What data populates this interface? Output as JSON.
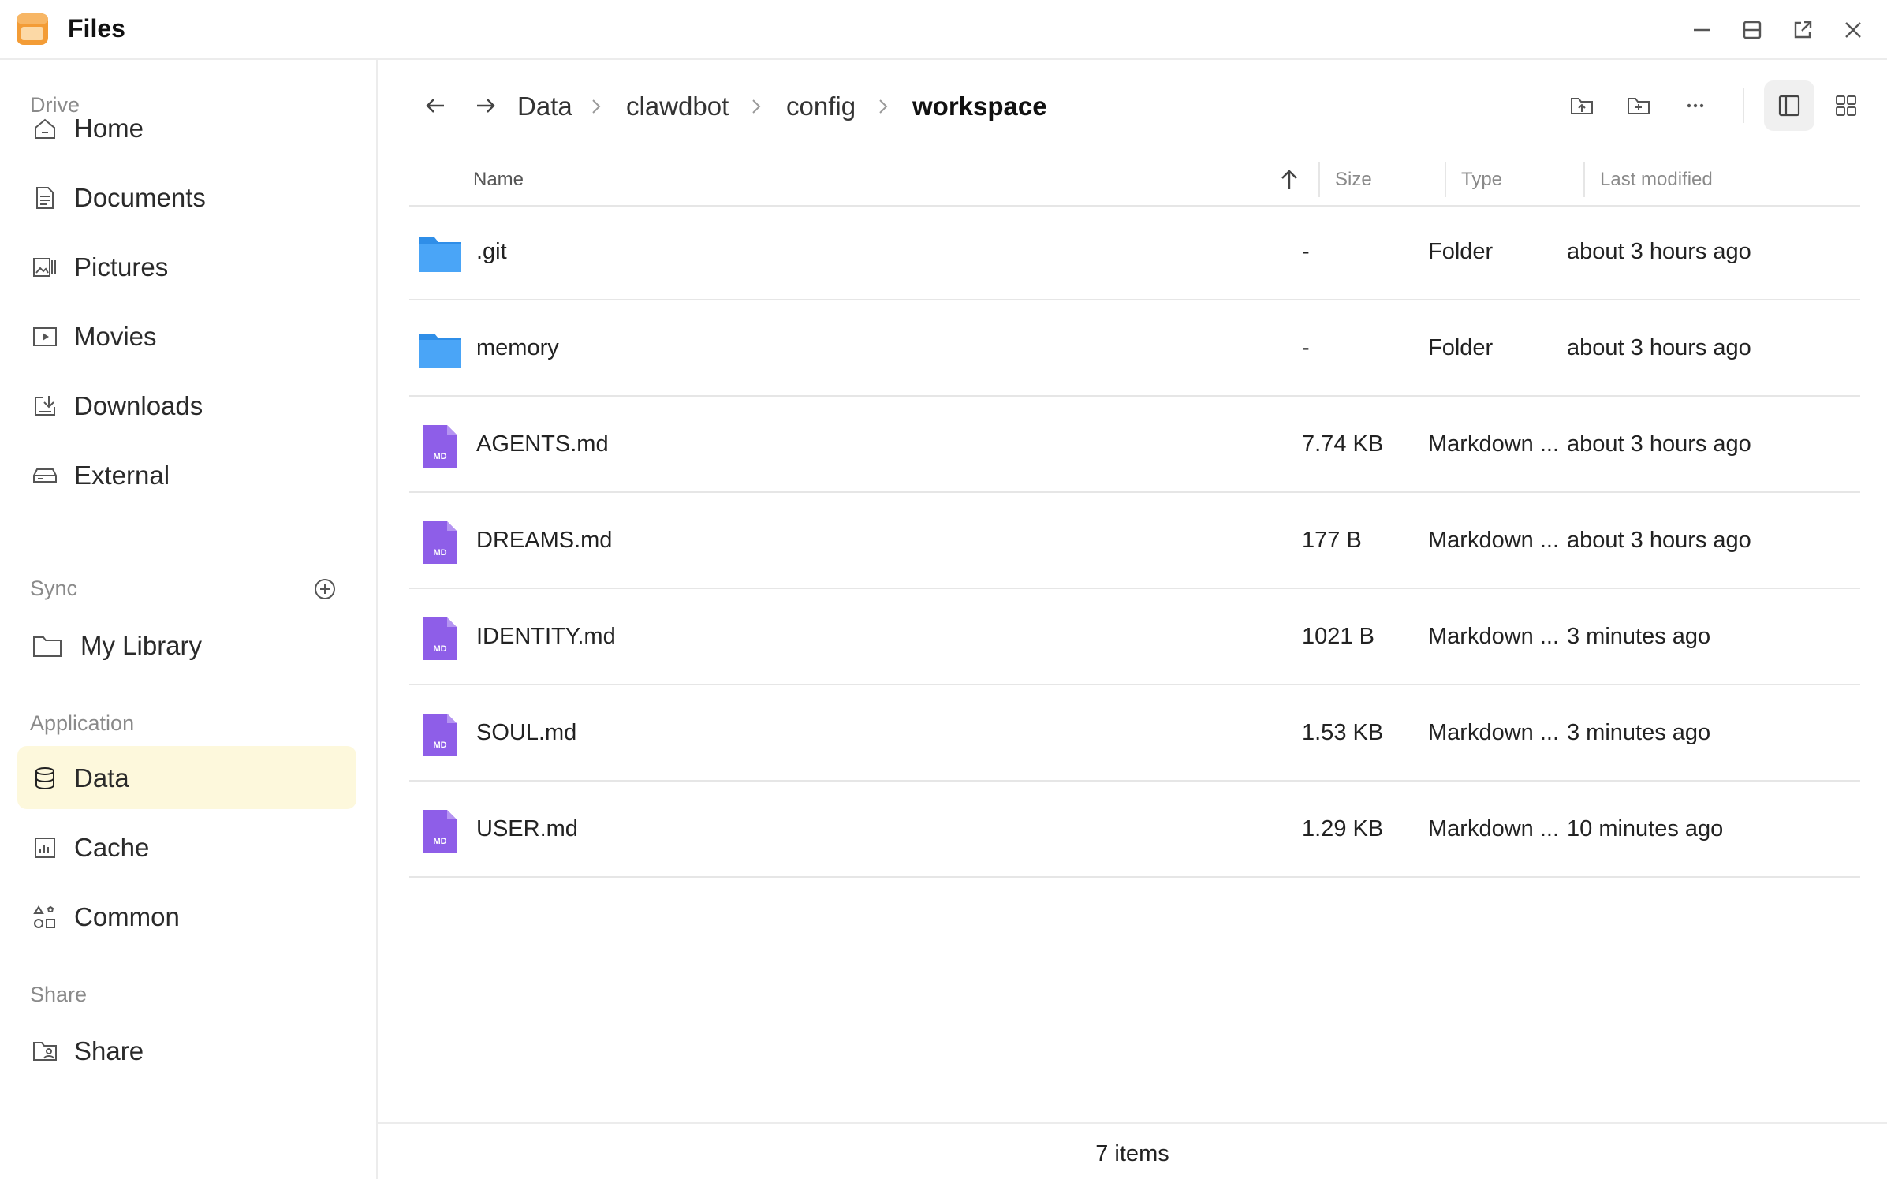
{
  "window": {
    "title": "Files",
    "controls": [
      "minimize-icon",
      "restore-icon",
      "popout-icon",
      "close-icon"
    ]
  },
  "sidebar": {
    "sections": [
      {
        "title": "Drive",
        "items": [
          {
            "label": "Home",
            "icon": "home-icon"
          },
          {
            "label": "Documents",
            "icon": "document-icon"
          },
          {
            "label": "Pictures",
            "icon": "pictures-icon"
          },
          {
            "label": "Movies",
            "icon": "movie-icon"
          },
          {
            "label": "Downloads",
            "icon": "download-icon"
          },
          {
            "label": "External",
            "icon": "drive-icon"
          }
        ]
      },
      {
        "title": "Sync",
        "items": [
          {
            "label": "My Library",
            "icon": "folder-icon"
          }
        ]
      },
      {
        "title": "Application",
        "items": [
          {
            "label": "Data",
            "icon": "database-icon",
            "active": true
          },
          {
            "label": "Cache",
            "icon": "cache-icon"
          },
          {
            "label": "Common",
            "icon": "apps-icon"
          }
        ]
      },
      {
        "title": "Share",
        "items": [
          {
            "label": "Share",
            "icon": "share-folder-icon"
          }
        ]
      }
    ]
  },
  "breadcrumb": [
    "Data",
    "clawdbot",
    "config",
    "workspace"
  ],
  "table": {
    "columns": [
      "Name",
      "Size",
      "Type",
      "Last modified"
    ],
    "rows": [
      {
        "name": ".git",
        "size": "-",
        "type": "Folder",
        "modified": "about 3 hours ago",
        "kind": "folder"
      },
      {
        "name": "memory",
        "size": "-",
        "type": "Folder",
        "modified": "about 3 hours ago",
        "kind": "folder"
      },
      {
        "name": "AGENTS.md",
        "size": "7.74 KB",
        "type": "Markdown ...",
        "modified": "about 3 hours ago",
        "kind": "md"
      },
      {
        "name": "DREAMS.md",
        "size": "177 B",
        "type": "Markdown ...",
        "modified": "about 3 hours ago",
        "kind": "md"
      },
      {
        "name": "IDENTITY.md",
        "size": "1021 B",
        "type": "Markdown ...",
        "modified": "3 minutes ago",
        "kind": "md"
      },
      {
        "name": "SOUL.md",
        "size": "1.53 KB",
        "type": "Markdown ...",
        "modified": "3 minutes ago",
        "kind": "md"
      },
      {
        "name": "USER.md",
        "size": "1.29 KB",
        "type": "Markdown ...",
        "modified": "10 minutes ago",
        "kind": "md"
      }
    ]
  },
  "md_badge": "MD",
  "footer": {
    "count": "7 items"
  },
  "colors": {
    "accent_active": "#fdf8dc",
    "folder": "#3d9af5",
    "markdown": "#8e5ee8",
    "app_icon": "#f39c36"
  }
}
